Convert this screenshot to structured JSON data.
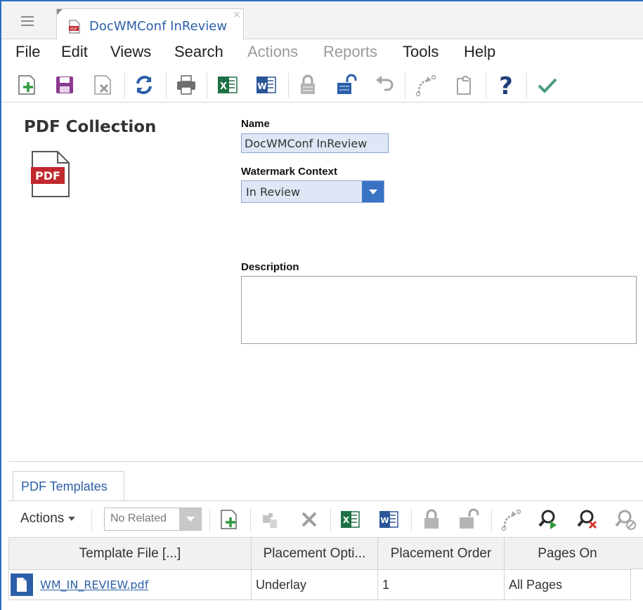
{
  "tab": {
    "title": "DocWMConf InReview",
    "close": "×"
  },
  "menu": [
    {
      "label": "File",
      "enabled": true
    },
    {
      "label": "Edit",
      "enabled": true
    },
    {
      "label": "Views",
      "enabled": true
    },
    {
      "label": "Search",
      "enabled": true
    },
    {
      "label": "Actions",
      "enabled": false
    },
    {
      "label": "Reports",
      "enabled": false
    },
    {
      "label": "Tools",
      "enabled": true
    },
    {
      "label": "Help",
      "enabled": true
    }
  ],
  "toolbar_icons": [
    "new-icon",
    "save-icon",
    "delete-icon",
    "refresh-icon",
    "print-icon",
    "excel-icon",
    "word-icon",
    "lock-icon",
    "unlock-icon",
    "undo-icon",
    "promote-icon",
    "copy-icon",
    "help-icon",
    "done-icon"
  ],
  "form": {
    "collection_title": "PDF Collection",
    "pdf_badge": "PDF",
    "name_label": "Name",
    "name_value": "DocWMConf InReview",
    "watermark_label": "Watermark Context",
    "watermark_value": "In Review",
    "description_label": "Description",
    "description_value": ""
  },
  "subpanel": {
    "tab_label": "PDF Templates",
    "actions_label": "Actions",
    "related_value": "No Related",
    "columns": [
      "Template File [...]",
      "Placement Opti...",
      "Placement Order",
      "Pages On"
    ],
    "rows": [
      {
        "file": "WM_IN_REVIEW.pdf",
        "placement": "Underlay",
        "order": "1",
        "pages": "All Pages"
      }
    ]
  },
  "colors": {
    "accent": "#2b6fc2",
    "link": "#2d5fa8",
    "excel": "#1e7145",
    "word": "#2b5797",
    "pdf_red": "#c0282d"
  }
}
